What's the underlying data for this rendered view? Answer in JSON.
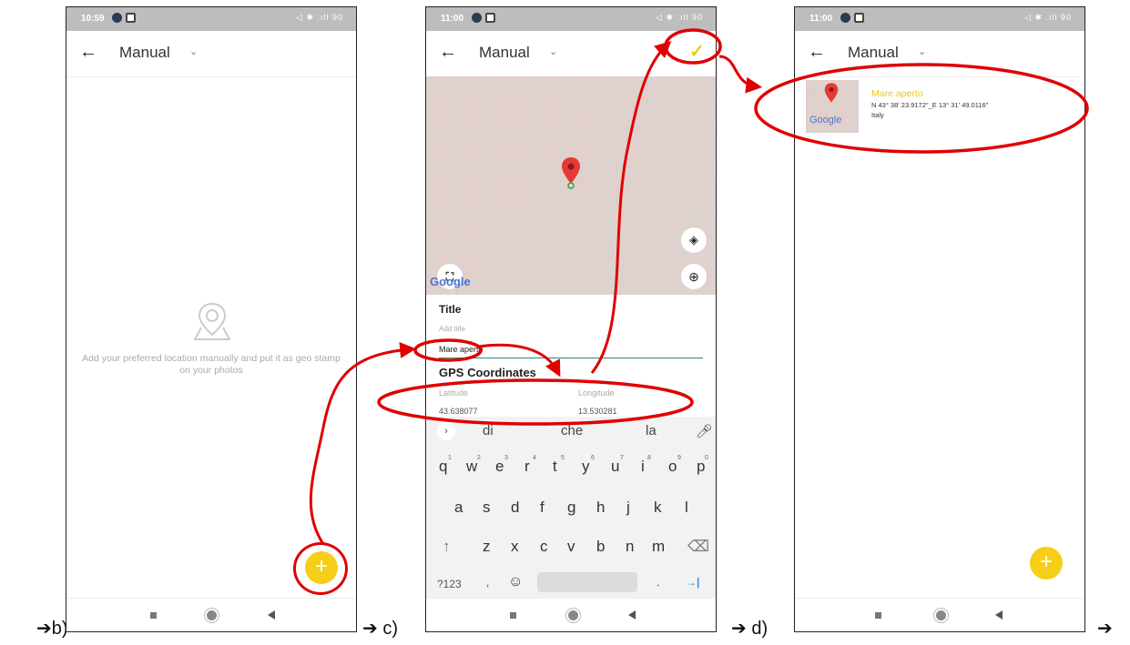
{
  "labels": {
    "b": "b)",
    "c": "c)",
    "d": "d)",
    "arrow": "➔"
  },
  "status": {
    "p1_time": "10:59",
    "p2_time": "11:00",
    "p3_time": "11:00",
    "p1_icons": "◁ ✱ .ıll 90",
    "p2_icons": "◁ ✱ .ıll 90",
    "p3_icons": "◁ ✱ .ıll 90"
  },
  "appbar": {
    "back_icon": "arrow-left",
    "title": "Manual",
    "chevron": "⌄",
    "confirm": "✓"
  },
  "empty_state": {
    "icon": "location-map-icon",
    "message": "Add your preferred location manually and put it as geo stamp on your photos"
  },
  "fab_label": "+",
  "form": {
    "map_watermark": "Google",
    "title_label": "Title",
    "title_placeholder": "Add title",
    "title_value": "Mare aperto",
    "gps_label": "GPS Coordinates",
    "lat_label": "Latitude",
    "lon_label": "Longitude",
    "lat_value": "43.638077",
    "lon_value": "13.530281"
  },
  "keyboard": {
    "suggestions": [
      "di",
      "che",
      "la"
    ],
    "row1": [
      "q",
      "w",
      "e",
      "r",
      "t",
      "y",
      "u",
      "i",
      "o",
      "p"
    ],
    "row1_hints": [
      "1",
      "2",
      "3",
      "4",
      "5",
      "6",
      "7",
      "8",
      "9",
      "0"
    ],
    "row2": [
      "a",
      "s",
      "d",
      "f",
      "g",
      "h",
      "j",
      "k",
      "l"
    ],
    "row3": [
      "↑",
      "z",
      "x",
      "c",
      "v",
      "b",
      "n",
      "m",
      "⌫"
    ],
    "row4": {
      "sym": "?123",
      "comma": ",",
      "emoji": "☺",
      "period": ".",
      "enter": "→|"
    }
  },
  "location": {
    "title": "Mare aperto",
    "coords": "N 43° 38' 23.9172\"_E 13° 31' 49.0116\"",
    "country": "Italy",
    "thumb_watermark": "Google"
  },
  "colors": {
    "accent": "#f7ce18",
    "annotation": "#e00000",
    "title_highlight": "#f2c81a",
    "field_underline": "#1f8c8c"
  }
}
